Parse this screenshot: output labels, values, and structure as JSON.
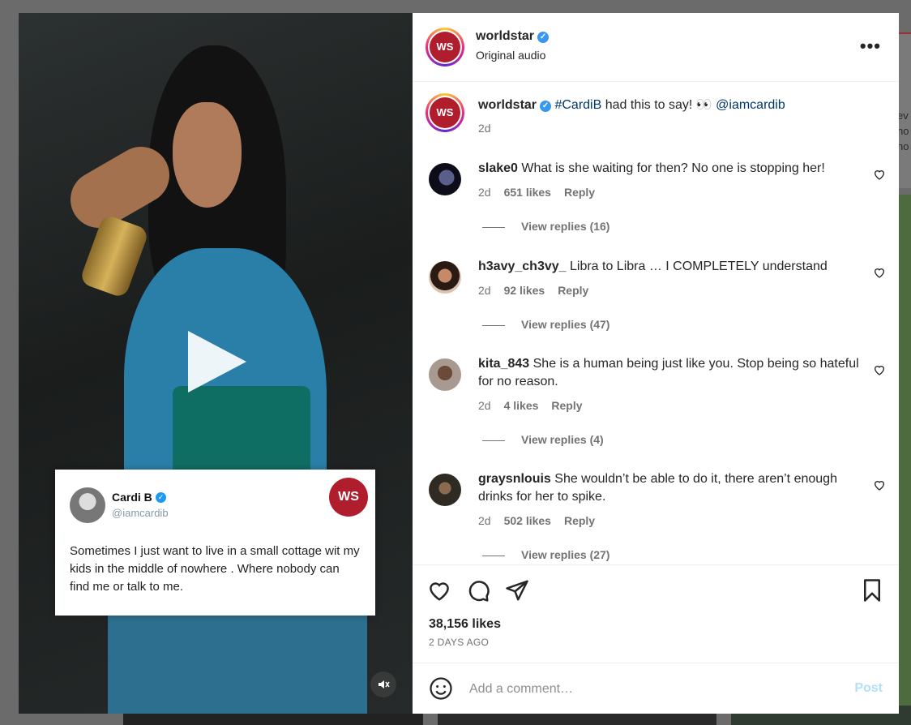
{
  "post": {
    "author": "worldstar",
    "audio": "Original audio",
    "caption_hashtag": "#CardiB",
    "caption_text": " had this to say! 👀 ",
    "caption_mention": "@iamcardib",
    "caption_time": "2d",
    "likes": "38,156 likes",
    "date": "2 DAYS AGO"
  },
  "media": {
    "tweet_name": "Cardi B",
    "tweet_handle": "@iamcardib",
    "tweet_text": "Sometimes I just want to live in a small cottage wit my kids in the middle of nowhere . Where nobody can find me or talk to me.",
    "logo_text": "WS",
    "tweet_verified": "✓"
  },
  "comments": [
    {
      "user": "slake0",
      "text": "What is she waiting for then? No one is stopping her!",
      "time": "2d",
      "likes": "651 likes",
      "reply": "Reply",
      "view_replies": "View replies (16)"
    },
    {
      "user": "h3avy_ch3vy_",
      "text": "Libra to Libra … I COMPLETELY understand",
      "time": "2d",
      "likes": "92 likes",
      "reply": "Reply",
      "view_replies": "View replies (47)"
    },
    {
      "user": "kita_843",
      "text": "She is a human being just like you. Stop being so hateful for no reason.",
      "time": "2d",
      "likes": "4 likes",
      "reply": "Reply",
      "view_replies": "View replies (4)"
    },
    {
      "user": "graysnlouis",
      "text": "She wouldn’t be able to do it, there aren’t enough drinks for her to spike.",
      "time": "2d",
      "likes": "502 likes",
      "reply": "Reply",
      "view_replies": "View replies (27)"
    }
  ],
  "composer": {
    "placeholder": "Add a comment…",
    "post_label": "Post"
  },
  "icons": {
    "more": "more-options-icon",
    "like": "heart-icon",
    "comment": "comment-icon",
    "share": "send-icon",
    "save": "bookmark-icon",
    "emoji": "emoji-icon",
    "mute": "muted-speaker-icon",
    "verified": "verified-badge-icon"
  },
  "colors": {
    "brand": "#b01e2e",
    "link": "#00376b",
    "post_disabled": "#b2dffc",
    "verified": "#3897f0"
  },
  "background_edge_text": [
    "ev",
    "no",
    "ho"
  ]
}
